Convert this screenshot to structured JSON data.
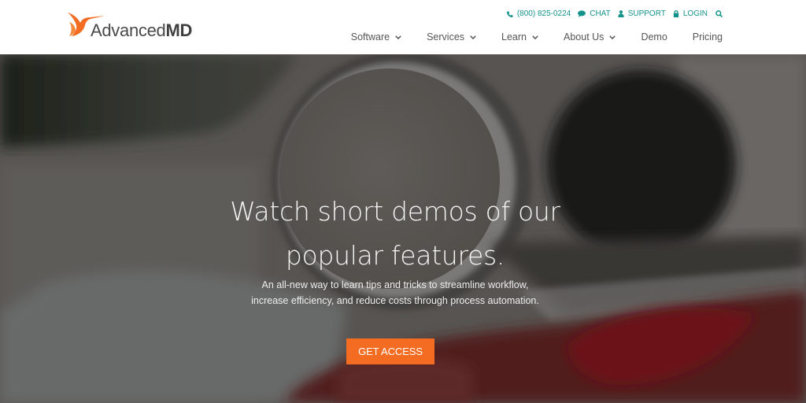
{
  "brand": {
    "name_regular": "Advanced",
    "name_bold": "MD",
    "accent_color": "#f36c21",
    "teal_color": "#15928c"
  },
  "utility_nav": {
    "phone": "(800) 825-0224",
    "chat": "CHAT",
    "support": "SUPPORT",
    "login": "LOGIN"
  },
  "main_nav": {
    "items": [
      {
        "label": "Software",
        "has_dropdown": true
      },
      {
        "label": "Services",
        "has_dropdown": true
      },
      {
        "label": "Learn",
        "has_dropdown": true
      },
      {
        "label": "About Us",
        "has_dropdown": true
      },
      {
        "label": "Demo",
        "has_dropdown": false
      },
      {
        "label": "Pricing",
        "has_dropdown": false
      }
    ]
  },
  "hero": {
    "title_line1": "Watch short demos of our",
    "title_line2": "popular features.",
    "subtitle": "An all-new way to learn tips and tricks to streamline workflow, increase efficiency, and reduce costs through process automation.",
    "cta_label": "GET ACCESS"
  }
}
